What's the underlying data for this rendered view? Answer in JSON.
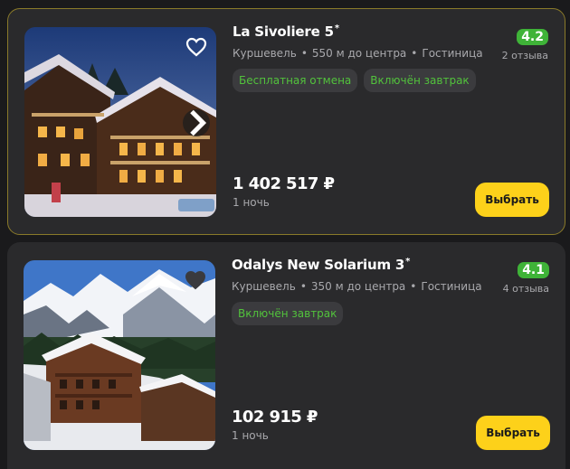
{
  "hotels": [
    {
      "name": "La Sivoliere 5",
      "stars_mark": "*",
      "location": "Куршевель",
      "distance": "550 м до центра",
      "type": "Гостиница",
      "dot": "•",
      "rating": "4.2",
      "reviews": "2 отзыва",
      "tags": [
        "Бесплатная отмена",
        "Включён завтрак"
      ],
      "price": "1 402 517 ₽",
      "period": "1 ночь",
      "button": "Выбрать",
      "favorite_icon": "heart-outline-icon",
      "has_next_arrow": true
    },
    {
      "name": "Odalys New Solarium 3",
      "stars_mark": "*",
      "location": "Куршевель",
      "distance": "350 м до центра",
      "type": "Гостиница",
      "dot": "•",
      "rating": "4.1",
      "reviews": "4 отзыва",
      "tags": [
        "Включён завтрак"
      ],
      "price": "102 915 ₽",
      "period": "1 ночь",
      "button": "Выбрать",
      "favorite_icon": "heart-filled-icon"
    }
  ],
  "colors": {
    "background": "#1a1a1c",
    "card": "#2a2a2c",
    "selected_border": "#8a7a2a",
    "rating_badge": "#3fb338",
    "tag_text": "#52c23c",
    "tag_bg": "#3b3b3e",
    "button": "#fdd11a",
    "secondary_text": "#a9a9ad"
  }
}
